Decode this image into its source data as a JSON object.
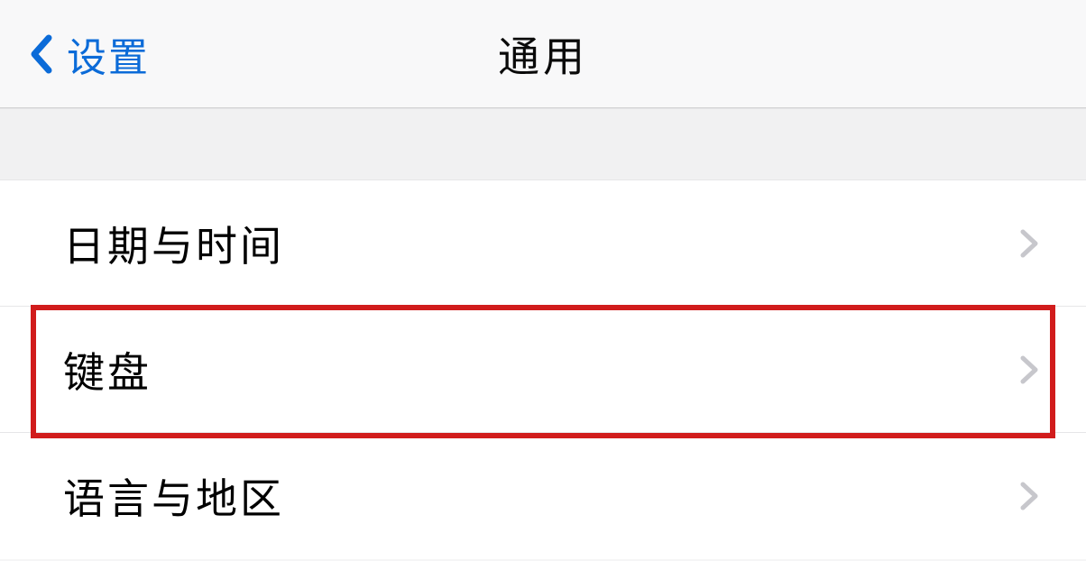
{
  "header": {
    "back_label": "设置",
    "title": "通用"
  },
  "rows": {
    "date_time": {
      "label": "日期与时间"
    },
    "keyboard": {
      "label": "键盘"
    },
    "language_region": {
      "label": "语言与地区"
    }
  },
  "colors": {
    "accent": "#0b6bd8",
    "highlight_border": "#d11c1c",
    "chevron": "#c7c7cc"
  }
}
